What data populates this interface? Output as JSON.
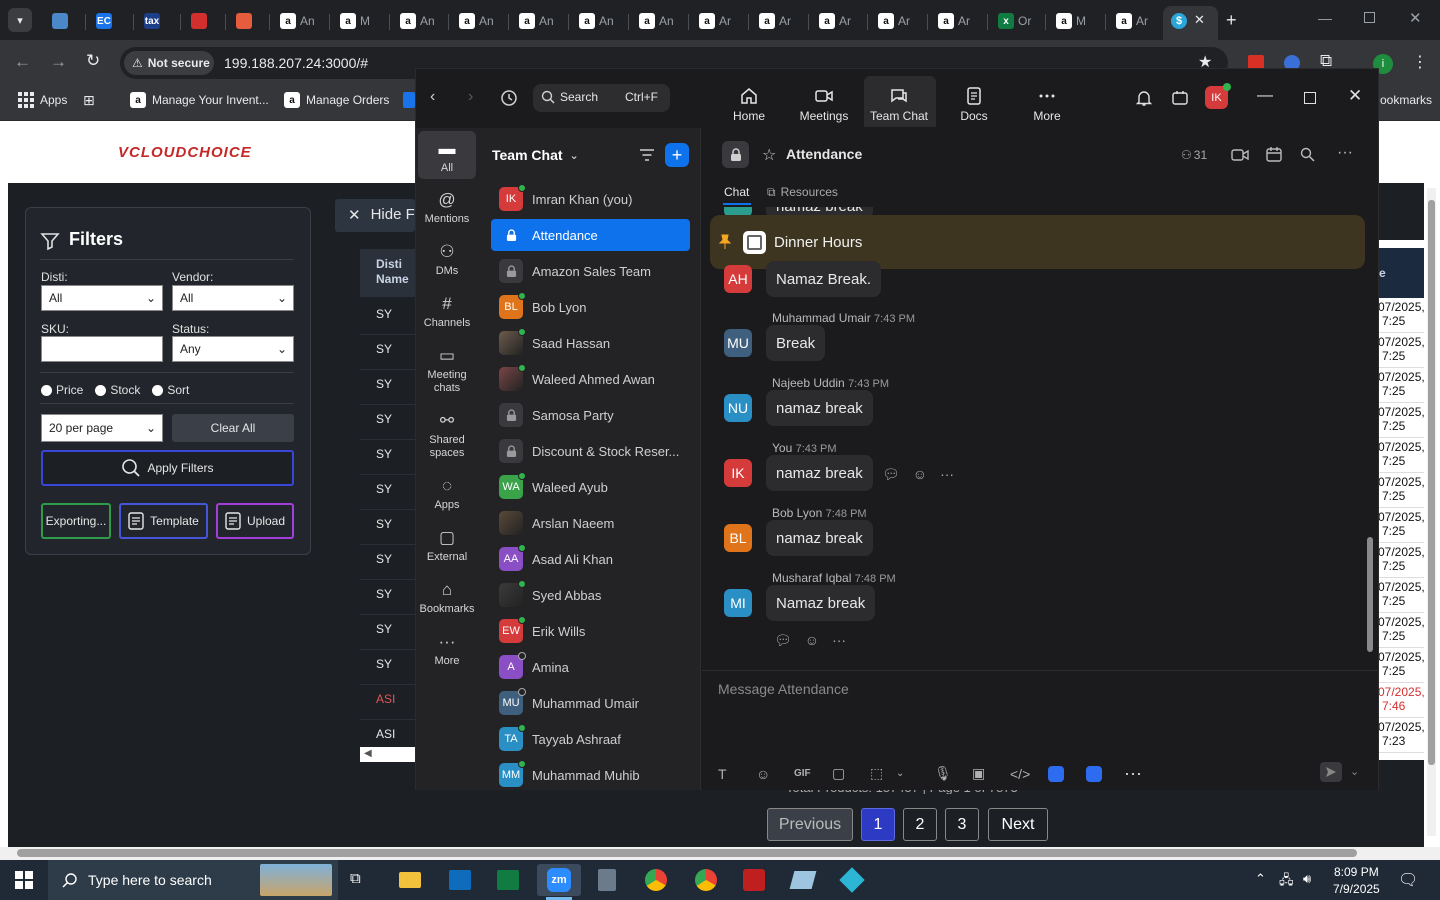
{
  "browser": {
    "tabs": [
      {
        "favicon": "generic-app-icon",
        "color": "#4a88c7",
        "letter": "",
        "label": ""
      },
      {
        "favicon": "ec-icon",
        "color": "#1a73e8",
        "letter": "EC",
        "label": ""
      },
      {
        "favicon": "tax-icon",
        "color": "#1d3f8a",
        "letter": "tax",
        "label": ""
      },
      {
        "favicon": "red-app-icon",
        "color": "#d32f2f",
        "letter": "",
        "label": ""
      },
      {
        "favicon": "box-icon",
        "color": "#e65c3c",
        "letter": "",
        "label": ""
      },
      {
        "favicon": "amazon-icon",
        "color": "#ffffff",
        "letter": "a",
        "label": "An"
      },
      {
        "favicon": "amazon-icon",
        "color": "#ffffff",
        "letter": "a",
        "label": "M"
      },
      {
        "favicon": "amazon-icon",
        "color": "#ffffff",
        "letter": "a",
        "label": "An"
      },
      {
        "favicon": "amazon-icon",
        "color": "#ffffff",
        "letter": "a",
        "label": "An"
      },
      {
        "favicon": "amazon-icon",
        "color": "#ffffff",
        "letter": "a",
        "label": "An"
      },
      {
        "favicon": "amazon-icon",
        "color": "#ffffff",
        "letter": "a",
        "label": "An"
      },
      {
        "favicon": "amazon-icon",
        "color": "#ffffff",
        "letter": "a",
        "label": "An"
      },
      {
        "favicon": "amazon-icon",
        "color": "#ffffff",
        "letter": "a",
        "label": "Ar"
      },
      {
        "favicon": "amazon-icon",
        "color": "#ffffff",
        "letter": "a",
        "label": "Ar"
      },
      {
        "favicon": "amazon-icon",
        "color": "#ffffff",
        "letter": "a",
        "label": "Ar"
      },
      {
        "favicon": "amazon-icon",
        "color": "#ffffff",
        "letter": "a",
        "label": "Ar"
      },
      {
        "favicon": "amazon-icon",
        "color": "#ffffff",
        "letter": "a",
        "label": "Ar"
      },
      {
        "favicon": "excel-icon",
        "color": "#107c41",
        "letter": "x",
        "label": "Or"
      },
      {
        "favicon": "amazon-icon",
        "color": "#ffffff",
        "letter": "a",
        "label": "M"
      },
      {
        "favicon": "amazon-icon",
        "color": "#ffffff",
        "letter": "a",
        "label": "Ar"
      }
    ],
    "active_tab_letter": "$",
    "security_label": "Not secure",
    "url": "199.188.207.24:3000/#",
    "bookmarks": [
      {
        "label": "Apps"
      },
      {
        "label": "Manage Your Invent..."
      },
      {
        "label": "Manage Orders"
      }
    ],
    "bookmarks_right": "ookmarks"
  },
  "webpage": {
    "logo": "VCLOUDCHOICE",
    "filters": {
      "title": "Filters",
      "disti_label": "Disti:",
      "disti_value": "All",
      "vendor_label": "Vendor:",
      "vendor_value": "All",
      "sku_label": "SKU:",
      "sku_value": "",
      "status_label": "Status:",
      "status_value": "Any",
      "radios": [
        "Price",
        "Stock",
        "Sort"
      ],
      "per_page_value": "20 per page",
      "clear_label": "Clear All",
      "apply_label": "Apply Filters",
      "export_label": "Exporting...",
      "template_label": "Template",
      "upload_label": "Upload"
    },
    "hide_label": "Hide F",
    "table": {
      "header": "Disti Name",
      "rows": [
        "SY",
        "SY",
        "SY",
        "SY",
        "SY",
        "SY",
        "SY",
        "SY",
        "SY",
        "SY",
        "SY",
        "ASI",
        "ASI"
      ],
      "right_header": "e",
      "right_cells": [
        [
          "07/2025,",
          "7:25"
        ],
        [
          "07/2025,",
          "7:25"
        ],
        [
          "07/2025,",
          "7:25"
        ],
        [
          "07/2025,",
          "7:25"
        ],
        [
          "07/2025,",
          "7:25"
        ],
        [
          "07/2025,",
          "7:25"
        ],
        [
          "07/2025,",
          "7:25"
        ],
        [
          "07/2025,",
          "7:25"
        ],
        [
          "07/2025,",
          "7:25"
        ],
        [
          "07/2025,",
          "7:25"
        ],
        [
          "07/2025,",
          "7:25"
        ],
        [
          "07/2025,",
          "7:46"
        ],
        [
          "07/2025,",
          "7:23"
        ]
      ]
    },
    "footer_text": "Total Products: 157457 | Page 1 of 7873",
    "pagination": {
      "prev": "Previous",
      "pages": [
        "1",
        "2",
        "3"
      ],
      "next": "Next"
    }
  },
  "zoom": {
    "search_label": "Search",
    "search_shortcut": "Ctrl+F",
    "nav": [
      {
        "label": "Home",
        "icon": "home-icon"
      },
      {
        "label": "Meetings",
        "icon": "video-icon"
      },
      {
        "label": "Team Chat",
        "icon": "chat-icon"
      },
      {
        "label": "Docs",
        "icon": "docs-icon"
      },
      {
        "label": "More",
        "icon": "more-icon"
      }
    ],
    "avatar_initials": "IK",
    "rail": [
      {
        "label": "All",
        "icon": "chat-bubble-icon"
      },
      {
        "label": "Mentions",
        "icon": "at-icon"
      },
      {
        "label": "DMs",
        "icon": "people-icon"
      },
      {
        "label": "Channels",
        "icon": "hash-icon"
      },
      {
        "label": "Meeting chats",
        "icon": "calendar-icon"
      },
      {
        "label": "Shared spaces",
        "icon": "shared-icon"
      },
      {
        "label": "Apps",
        "icon": "apps-icon"
      },
      {
        "label": "External",
        "icon": "external-icon"
      },
      {
        "label": "Bookmarks",
        "icon": "bookmark-icon"
      },
      {
        "label": "More",
        "icon": "more-icon"
      }
    ],
    "list_title": "Team Chat",
    "chats": [
      {
        "name": "Imran Khan (you)",
        "initials": "IK",
        "color": "#d63b3b",
        "status": "online",
        "kind": "person"
      },
      {
        "name": "Attendance",
        "initials": "",
        "color": "",
        "status": "",
        "kind": "lock",
        "active": true
      },
      {
        "name": "Amazon Sales Team",
        "initials": "",
        "color": "",
        "status": "",
        "kind": "lock"
      },
      {
        "name": "Bob Lyon",
        "initials": "BL",
        "color": "#e0741b",
        "status": "online",
        "kind": "person"
      },
      {
        "name": "Saad Hassan",
        "initials": "",
        "color": "#6d5b4d",
        "status": "online",
        "kind": "photo"
      },
      {
        "name": "Waleed Ahmed Awan",
        "initials": "",
        "color": "#7a4646",
        "status": "online",
        "kind": "photo"
      },
      {
        "name": "Samosa Party",
        "initials": "",
        "color": "",
        "status": "",
        "kind": "lock"
      },
      {
        "name": "Discount & Stock Reser...",
        "initials": "",
        "color": "",
        "status": "",
        "kind": "lock"
      },
      {
        "name": "Waleed Ayub",
        "initials": "WA",
        "color": "#3aa34a",
        "status": "online",
        "kind": "person"
      },
      {
        "name": "Arslan Naeem",
        "initials": "",
        "color": "#5a4a3a",
        "status": "",
        "kind": "photo"
      },
      {
        "name": "Asad Ali Khan",
        "initials": "AA",
        "color": "#8a4fc4",
        "status": "online",
        "kind": "person"
      },
      {
        "name": "Syed Abbas",
        "initials": "",
        "color": "#3b3b3b",
        "status": "online",
        "kind": "photo"
      },
      {
        "name": "Erik Wills",
        "initials": "EW",
        "color": "#d63b3b",
        "status": "online",
        "kind": "person"
      },
      {
        "name": "Amina",
        "initials": "A",
        "color": "#8a4fc4",
        "status": "offline",
        "kind": "person"
      },
      {
        "name": "Muhammad Umair",
        "initials": "MU",
        "color": "#3f5f7f",
        "status": "offline",
        "kind": "person"
      },
      {
        "name": "Tayyab Ashraaf",
        "initials": "TA",
        "color": "#2a8fc4",
        "status": "online",
        "kind": "person"
      },
      {
        "name": "Muhammad Muhib",
        "initials": "MM",
        "color": "#2a8fc4",
        "status": "online",
        "kind": "person"
      }
    ],
    "channel": {
      "name": "Attendance",
      "member_count": "31",
      "tabs": [
        "Chat",
        "Resources"
      ],
      "pinned": "Dinner Hours",
      "partial_top": "namaz break"
    },
    "messages": [
      {
        "sender": "",
        "time": "",
        "initials": "AH",
        "color": "#d63b3b",
        "text": "Namaz Break."
      },
      {
        "sender": "Muhammad Umair",
        "time": "7:43 PM",
        "initials": "MU",
        "color": "#3f5f7f",
        "text": "Break"
      },
      {
        "sender": "Najeeb Uddin",
        "time": "7:43 PM",
        "initials": "NU",
        "color": "#2a8fc4",
        "text": "namaz break"
      },
      {
        "sender": "You",
        "time": "7:43 PM",
        "initials": "IK",
        "color": "#d63b3b",
        "text": "namaz break"
      },
      {
        "sender": "Bob Lyon",
        "time": "7:48 PM",
        "initials": "BL",
        "color": "#e0741b",
        "text": "namaz break"
      },
      {
        "sender": "Musharaf Iqbal",
        "time": "7:48 PM",
        "initials": "MI",
        "color": "#2a8fc4",
        "text": "Namaz break"
      }
    ],
    "composer_placeholder": "Message Attendance",
    "composer_gif": "GIF"
  },
  "taskbar": {
    "search_placeholder": "Type here to search",
    "time": "8:09 PM",
    "date": "7/9/2025",
    "zoom_label": "zm"
  },
  "colors": {
    "zoom_accent": "#0e72ed",
    "pinned_bg": "#3e3520",
    "pin_color": "#f5a623",
    "page_button_blue": "#2d3bc4"
  }
}
